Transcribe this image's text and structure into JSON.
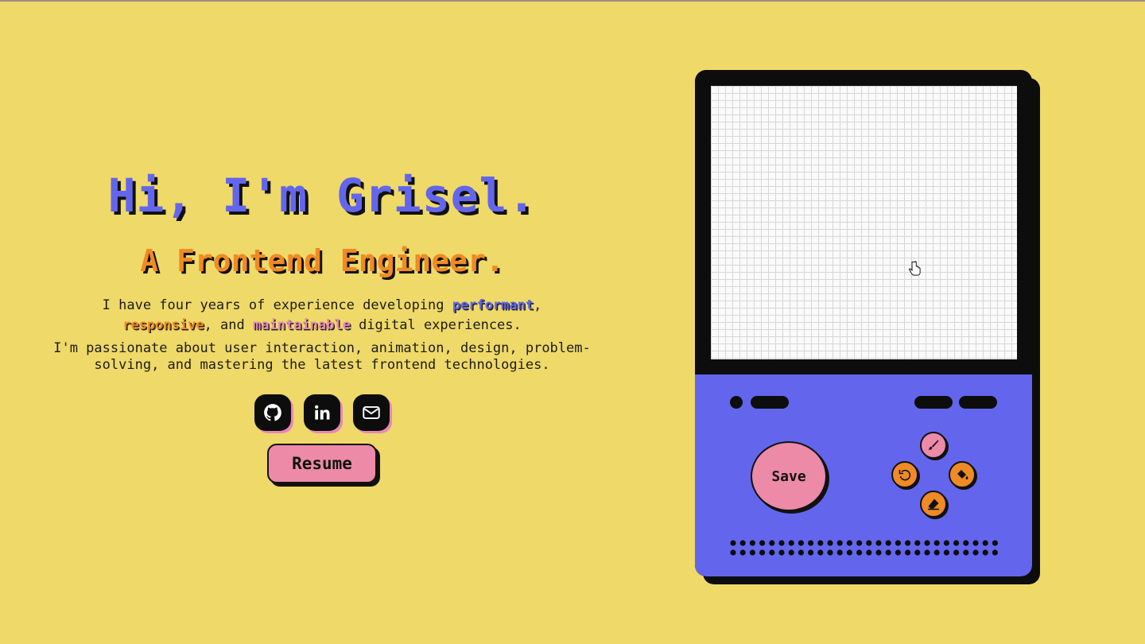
{
  "intro": {
    "heading": "Hi, I'm Grisel.",
    "subheading": "A Frontend Engineer.",
    "desc": {
      "part1": "I have four years of experience developing ",
      "highlight1": "performant",
      "part2": ",",
      "highlight2": "responsive",
      "part3": ", and ",
      "highlight3": "maintainable",
      "part4": " digital experiences."
    },
    "passion": "I'm passionate about user interaction, animation, design, problem-solving, and mastering the latest frontend technologies."
  },
  "socials": [
    {
      "name": "GitHub",
      "icon": "github-icon"
    },
    {
      "name": "LinkedIn",
      "icon": "linkedin-icon"
    },
    {
      "name": "Email",
      "icon": "mail-icon"
    }
  ],
  "resume_label": "Resume",
  "device": {
    "save_label": "Save",
    "tools": [
      {
        "icon": "brush-icon",
        "color": "#ec8aa8"
      },
      {
        "icon": "undo-icon",
        "color": "#f08a24"
      },
      {
        "icon": "fill-bucket-icon",
        "color": "#f08a24"
      },
      {
        "icon": "eraser-icon",
        "color": "#f08a24"
      }
    ]
  },
  "colors": {
    "background": "#efd968",
    "accent_blue": "#6366ec",
    "accent_orange": "#f08a24",
    "accent_pink": "#ec8aa8",
    "ink": "#0d0d0d"
  }
}
